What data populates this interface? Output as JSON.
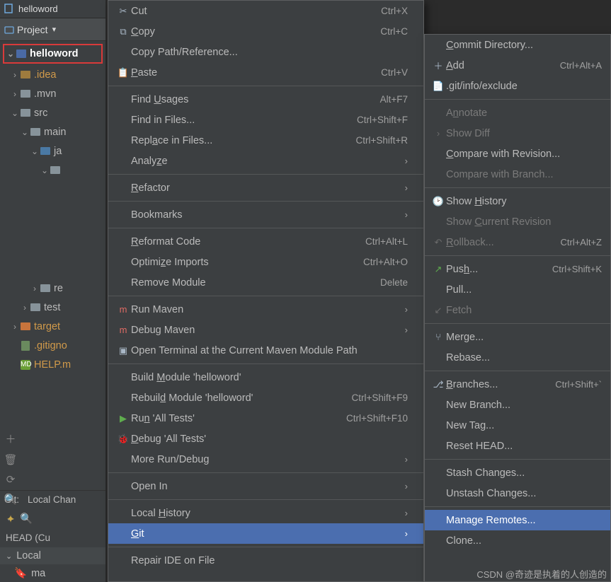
{
  "title_tab": "helloword",
  "proj_header": "Project",
  "tree": {
    "root": "helloword",
    "idea": ".idea",
    "mvn": ".mvn",
    "src": "src",
    "main": "main",
    "ja": "ja",
    "re": "re",
    "test": "test",
    "target": "target",
    "gitignore": ".gitigno",
    "help": "HELP.m"
  },
  "gitbar": {
    "label": "Git:",
    "scope": "Local Chan"
  },
  "commitlist": {
    "head": "HEAD (Cu",
    "local": "Local",
    "branch": "ma"
  },
  "menu1": {
    "cut": "Cut",
    "cut_sc": "Ctrl+X",
    "copy": "Copy",
    "copy_sc": "Ctrl+C",
    "copypath": "Copy Path/Reference...",
    "paste": "Paste",
    "paste_sc": "Ctrl+V",
    "findusages": "Find Usages",
    "findusages_sc": "Alt+F7",
    "findfiles": "Find in Files...",
    "findfiles_sc": "Ctrl+Shift+F",
    "replacefiles": "Replace in Files...",
    "replacefiles_sc": "Ctrl+Shift+R",
    "analyze": "Analyze",
    "refactor": "Refactor",
    "bookmarks": "Bookmarks",
    "reformat": "Reformat Code",
    "reformat_sc": "Ctrl+Alt+L",
    "optimize": "Optimize Imports",
    "optimize_sc": "Ctrl+Alt+O",
    "removemodule": "Remove Module",
    "removemodule_sc": "Delete",
    "runmaven": "Run Maven",
    "debugmaven": "Debug Maven",
    "openterm": "Open Terminal at the Current Maven Module Path",
    "buildmod": "Build Module 'helloword'",
    "rebuildmod": "Rebuild Module 'helloword'",
    "rebuildmod_sc": "Ctrl+Shift+F9",
    "runtests": "Run 'All Tests'",
    "runtests_sc": "Ctrl+Shift+F10",
    "debugtests": "Debug 'All Tests'",
    "morerun": "More Run/Debug",
    "openin": "Open In",
    "localhistory": "Local History",
    "git": "Git",
    "repairide": "Repair IDE on File"
  },
  "menu2": {
    "commitdir": "Commit Directory...",
    "add": "Add",
    "add_sc": "Ctrl+Alt+A",
    "gitexclude": ".git/info/exclude",
    "annotate": "Annotate",
    "showdiff": "Show Diff",
    "comparerev": "Compare with Revision...",
    "comparebranch": "Compare with Branch...",
    "showhistory": "Show History",
    "showcurrent": "Show Current Revision",
    "rollback": "Rollback...",
    "rollback_sc": "Ctrl+Alt+Z",
    "push": "Push...",
    "push_sc": "Ctrl+Shift+K",
    "pull": "Pull...",
    "fetch": "Fetch",
    "merge": "Merge...",
    "rebase": "Rebase...",
    "branches": "Branches...",
    "branches_sc": "Ctrl+Shift+`",
    "newbranch": "New Branch...",
    "newtag": "New Tag...",
    "resethead": "Reset HEAD...",
    "stash": "Stash Changes...",
    "unstash": "Unstash Changes...",
    "manageremotes": "Manage Remotes...",
    "clone": "Clone..."
  },
  "watermark": "CSDN @奇迹是执着的人创造的"
}
